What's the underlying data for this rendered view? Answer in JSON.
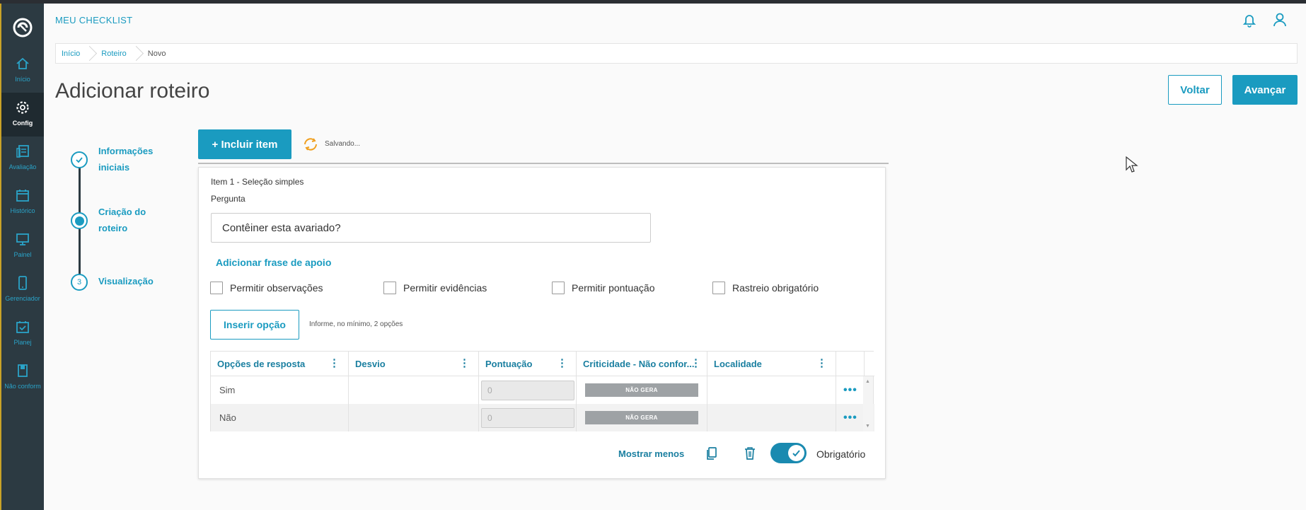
{
  "app_title": "MEU CHECKLIST",
  "sidebar": {
    "items": [
      {
        "label": "Início",
        "icon": "home-icon"
      },
      {
        "label": "Config",
        "icon": "gear-icon"
      },
      {
        "label": "Avaliação",
        "icon": "evaluation-icon"
      },
      {
        "label": "Histórico",
        "icon": "calendar-icon"
      },
      {
        "label": "Painel",
        "icon": "monitor-icon"
      },
      {
        "label": "Gerenciador",
        "icon": "mobile-icon"
      },
      {
        "label": "Planej",
        "icon": "calendar-check-icon"
      },
      {
        "label": "Não conform",
        "icon": "book-icon"
      }
    ]
  },
  "breadcrumb": [
    "Início",
    "Roteiro",
    "Novo"
  ],
  "page_title": "Adicionar roteiro",
  "buttons": {
    "voltar": "Voltar",
    "avancar": "Avançar",
    "incluir": "+ Incluir item",
    "inserir": "Inserir opção"
  },
  "saving_text": "Salvando...",
  "steps": [
    {
      "label": "Informações iniciais",
      "state": "done"
    },
    {
      "label": "Criação do roteiro",
      "state": "active"
    },
    {
      "label": "Visualização",
      "number": "3",
      "state": "pending"
    }
  ],
  "item": {
    "title": "Item 1 - Seleção simples",
    "pergunta_label": "Pergunta",
    "pergunta_value": "Contêiner esta avariado?",
    "add_frase": "Adicionar frase de apoio",
    "checkboxes": [
      "Permitir observações",
      "Permitir evidências",
      "Permitir pontuação",
      "Rastreio obrigatório"
    ],
    "inserir_hint": "Informe, no mínimo, 2 opções",
    "table": {
      "headers": [
        "Opções de resposta",
        "Desvio",
        "Pontuação",
        "Criticidade - Não confor...",
        "Localidade"
      ],
      "rows": [
        {
          "opcao": "Sim",
          "desvio": "",
          "pontuacao": "0",
          "criticidade": "NÃO GERA",
          "localidade": ""
        },
        {
          "opcao": "Não",
          "desvio": "",
          "pontuacao": "0",
          "criticidade": "NÃO GERA",
          "localidade": ""
        }
      ]
    },
    "mostrar_menos": "Mostrar menos",
    "obrigatorio_label": "Obrigatório",
    "obrigatorio_on": true
  },
  "colors": {
    "accent": "#1a9bc0",
    "sidebar": "#2c3a42"
  }
}
